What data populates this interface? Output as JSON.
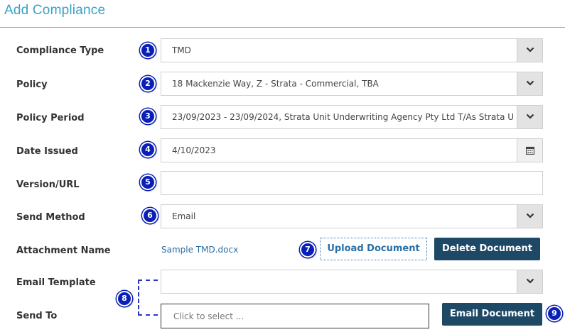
{
  "header": {
    "title": "Add Compliance"
  },
  "form": {
    "compliance_type": {
      "label": "Compliance Type",
      "value": "TMD",
      "badge": "1"
    },
    "policy": {
      "label": "Policy",
      "value": "18 Mackenzie Way, Z - Strata - Commercial, TBA",
      "badge": "2"
    },
    "policy_period": {
      "label": "Policy Period",
      "value": "23/09/2023 - 23/09/2024, Strata Unit Underwriting Agency Pty Ltd T/As Strata Unit U",
      "badge": "3"
    },
    "date_issued": {
      "label": "Date Issued",
      "value": "4/10/2023",
      "badge": "4",
      "icon": "calendar-icon"
    },
    "version_url": {
      "label": "Version/URL",
      "value": "",
      "badge": "5"
    },
    "send_method": {
      "label": "Send Method",
      "value": "Email",
      "badge": "6"
    },
    "attachment": {
      "label": "Attachment Name",
      "file_name": "Sample TMD.docx",
      "badge": "7",
      "upload_label": "Upload Document",
      "delete_label": "Delete Document"
    },
    "email_template": {
      "label": "Email Template",
      "value": "",
      "badge": "8"
    },
    "send_to": {
      "label": "Send To",
      "placeholder": "Click to select ...",
      "email_label": "Email Document",
      "badge": "9"
    }
  },
  "colors": {
    "accent": "#3ba2c4",
    "badge": "#0a1fb5",
    "primary_button": "#1d4866",
    "link": "#2a6fa6"
  }
}
